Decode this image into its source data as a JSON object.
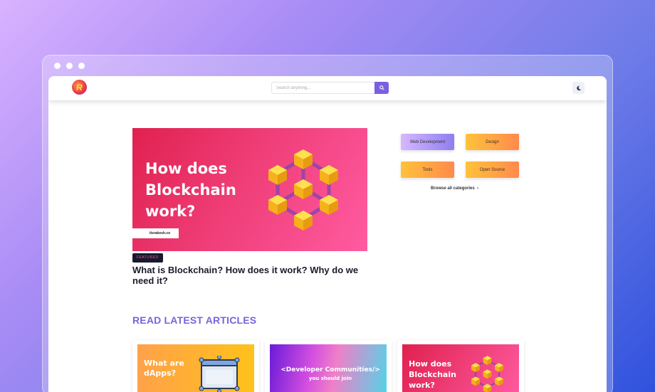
{
  "search": {
    "placeholder": "Search anything..."
  },
  "featured": {
    "image_text": "How does Blockchain work?",
    "watermark": "itsrakesh.co",
    "badge": "FEATURED",
    "title": "What is Blockchain? How does it work? Why do we need it?"
  },
  "categories": [
    {
      "label": "Web Development"
    },
    {
      "label": "Design"
    },
    {
      "label": "Tools"
    },
    {
      "label": "Open Source"
    }
  ],
  "browse_label": "Browse all categories",
  "section_title": "READ LATEST ARTICLES",
  "cards": [
    {
      "image_text": "What are dApps?"
    },
    {
      "image_text": "<Developer Communities/>",
      "subtext": "you should join"
    },
    {
      "image_text": "How does Blockchain work?"
    }
  ],
  "colors": {
    "accent": "#7b5fe0",
    "heading": "#7a63d9",
    "pink": "#ef3d77"
  }
}
